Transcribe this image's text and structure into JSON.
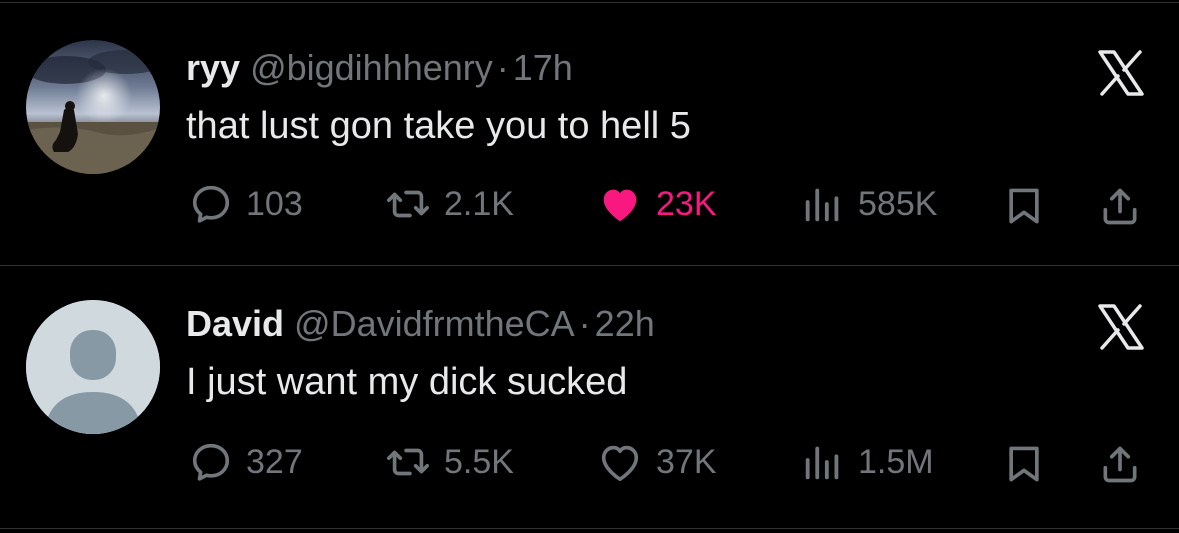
{
  "tweets": [
    {
      "name": "ryy",
      "handle": "@bigdihhhenry",
      "sep": "·",
      "time": "17h",
      "text": "that lust gon take you to hell 5",
      "replies": "103",
      "retweets": "2.1K",
      "likes": "23K",
      "liked": true,
      "views": "585K",
      "avatar": "photo-avatar"
    },
    {
      "name": "David",
      "handle": "@DavidfrmtheCA",
      "sep": "·",
      "time": "22h",
      "text": "I just want my dick sucked",
      "replies": "327",
      "retweets": "5.5K",
      "likes": "37K",
      "liked": false,
      "views": "1.5M",
      "avatar": "default-avatar"
    }
  ],
  "colors": {
    "background": "#000000",
    "text_primary": "#e7e9ea",
    "text_secondary": "#71767b",
    "like_active": "#f91880",
    "divider": "#2f3336"
  },
  "icons": [
    "reply-icon",
    "retweet-icon",
    "heart-icon",
    "views-icon",
    "bookmark-icon",
    "share-icon",
    "x-logo-icon"
  ]
}
